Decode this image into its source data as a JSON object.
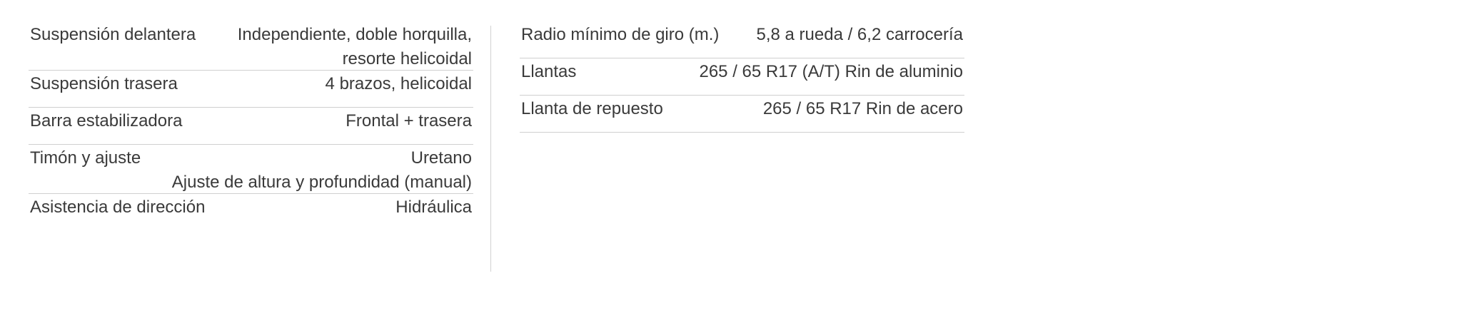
{
  "specs": {
    "left": [
      {
        "label": "Suspensión delantera",
        "value_lines": [
          "Independiente, doble horquilla,",
          "resorte helicoidal"
        ]
      },
      {
        "label": "Suspensión trasera",
        "value_lines": [
          "4 brazos, helicoidal"
        ]
      },
      {
        "label": "Barra estabilizadora",
        "value_lines": [
          "Frontal + trasera"
        ]
      },
      {
        "label": "Timón y ajuste",
        "value_lines": [
          "Uretano",
          "Ajuste de altura y profundidad (manual)"
        ]
      },
      {
        "label": "Asistencia de dirección",
        "value_lines": [
          "Hidráulica"
        ]
      }
    ],
    "right": [
      {
        "label": "Radio mínimo de giro (m.)",
        "value_lines": [
          "5,8 a rueda / 6,2 carrocería"
        ]
      },
      {
        "label": "Llantas",
        "value_lines": [
          "265 / 65 R17 (A/T) Rin de aluminio"
        ]
      },
      {
        "label": "Llanta de repuesto",
        "value_lines": [
          "265 / 65 R17 Rin de acero"
        ]
      }
    ]
  },
  "colors": {
    "text": "#3a3a3a",
    "rule": "#cfcfcf",
    "divider": "#d2d2d2"
  }
}
